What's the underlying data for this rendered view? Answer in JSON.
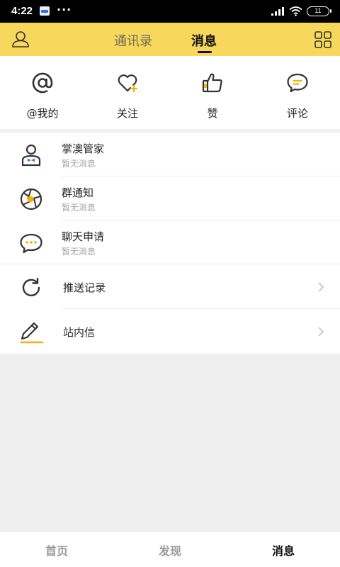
{
  "status_bar": {
    "time": "4:22",
    "dots": "···",
    "battery": "11"
  },
  "header": {
    "tabs": [
      {
        "label": "通讯录",
        "active": false
      },
      {
        "label": "消息",
        "active": true
      }
    ],
    "left_icon": "user-icon",
    "right_icon": "grid-icon"
  },
  "quick_actions": [
    {
      "label": "@我的",
      "icon": "at-icon"
    },
    {
      "label": "关注",
      "icon": "heart-plus-icon"
    },
    {
      "label": "赞",
      "icon": "thumbs-up-icon"
    },
    {
      "label": "评论",
      "icon": "comment-icon"
    }
  ],
  "message_list": [
    {
      "title": "掌澳管家",
      "subtitle": "暂无消息",
      "icon": "butler-icon"
    },
    {
      "title": "群通知",
      "subtitle": "暂无消息",
      "icon": "aperture-icon"
    },
    {
      "title": "聊天申请",
      "subtitle": "暂无消息",
      "icon": "chat-bubble-icon"
    },
    {
      "title": "推送记录",
      "icon": "refresh-icon"
    },
    {
      "title": "站内信",
      "icon": "pencil-icon"
    }
  ],
  "bottom_nav": [
    {
      "label": "首页",
      "active": false
    },
    {
      "label": "发现",
      "active": false
    },
    {
      "label": "消息",
      "active": true
    }
  ],
  "colors": {
    "accent": "#f7d85c",
    "icon_accent": "#f3b400"
  }
}
